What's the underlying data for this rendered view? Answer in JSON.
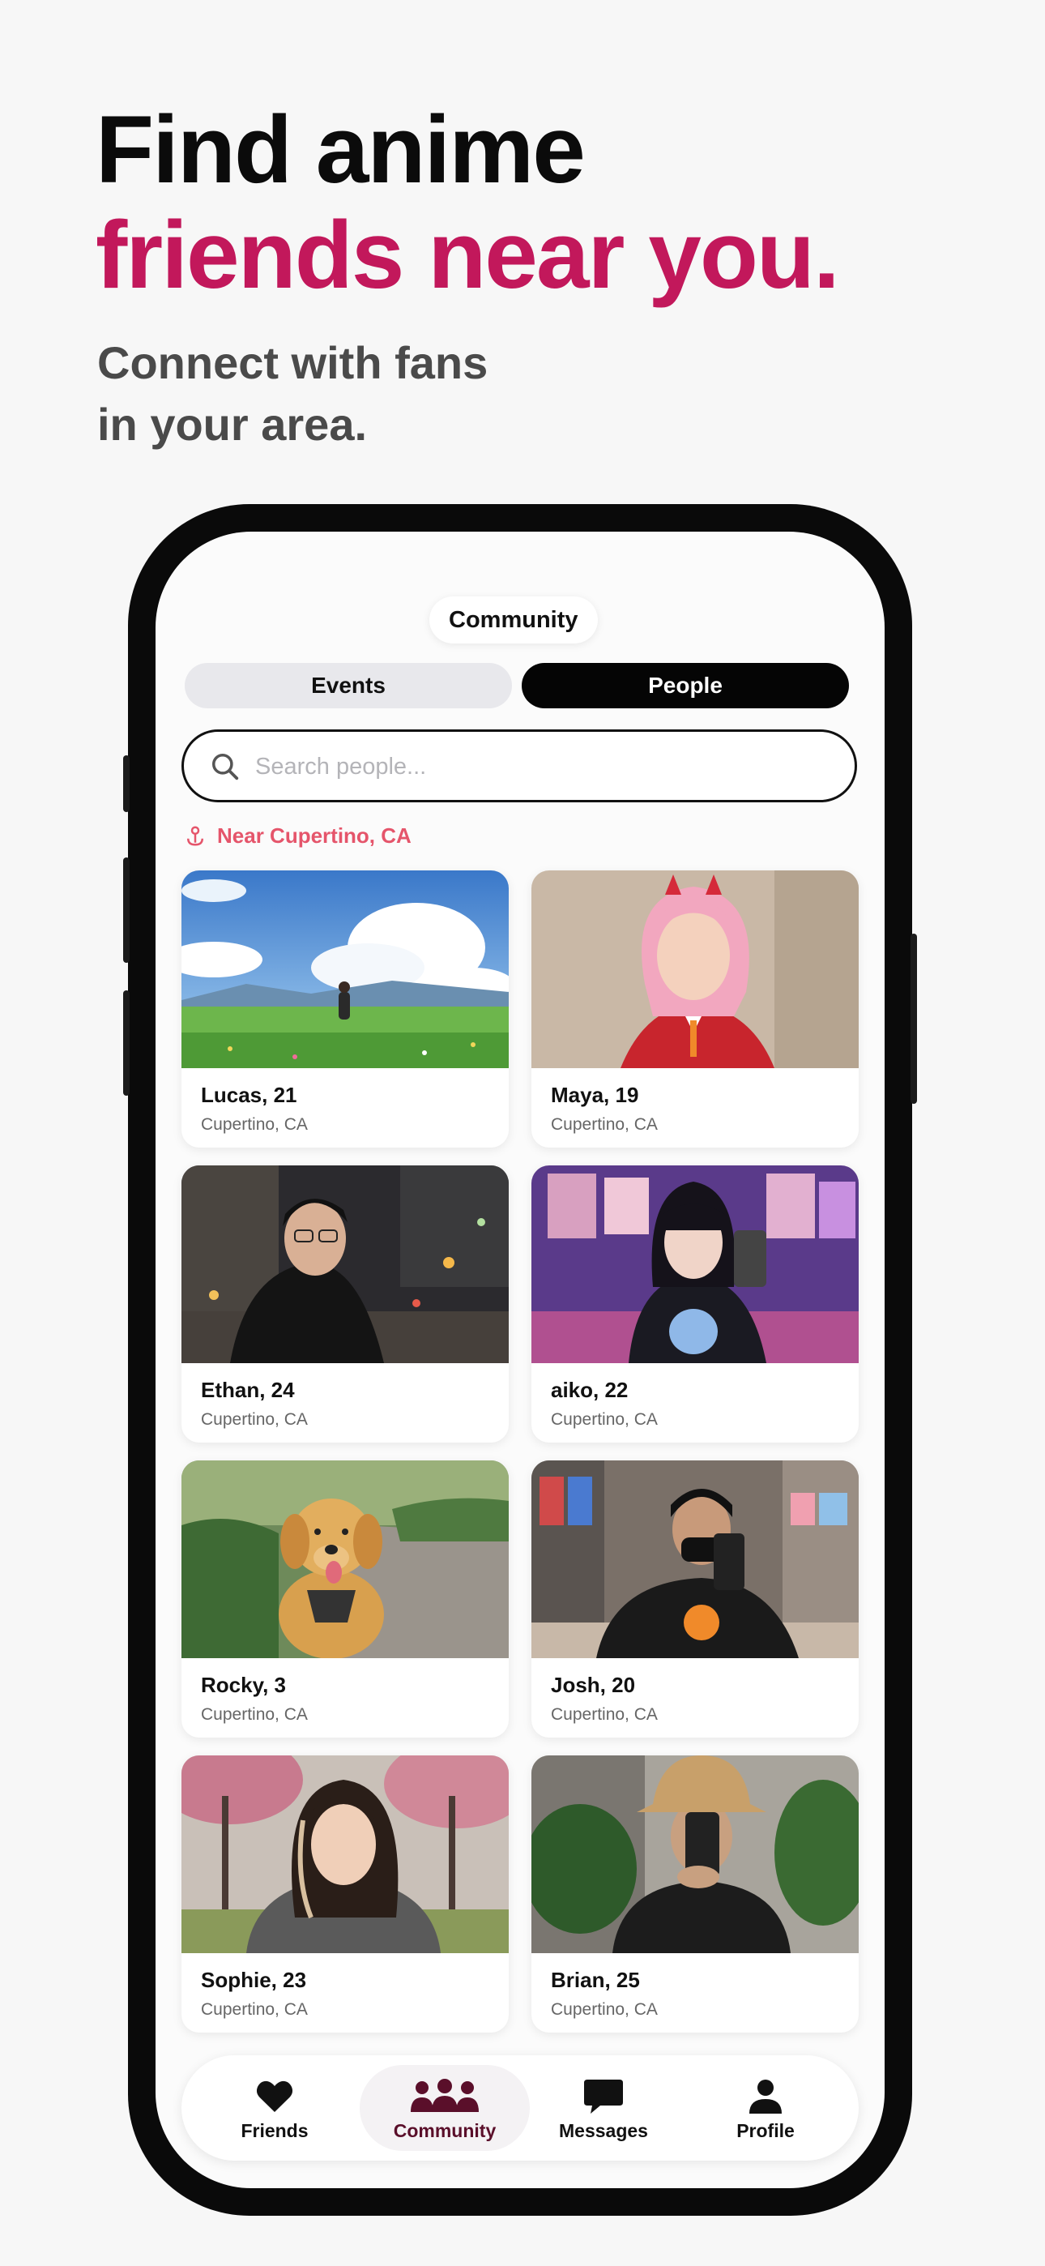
{
  "headline": {
    "line1": "Find anime",
    "line2": "friends near you."
  },
  "subline": {
    "line1": "Connect with fans",
    "line2": "in your area."
  },
  "app": {
    "title": "Community",
    "segments": {
      "events": "Events",
      "people": "People",
      "active": "People"
    },
    "search": {
      "placeholder": "Search people...",
      "value": ""
    },
    "location": "Near Cupertino, CA",
    "people": [
      {
        "name": "Lucas, 21",
        "city": "Cupertino, CA",
        "photo": "anime-landscape"
      },
      {
        "name": "Maya, 19",
        "city": "Cupertino, CA",
        "photo": "cosplay-portrait"
      },
      {
        "name": "Ethan, 24",
        "city": "Cupertino, CA",
        "photo": "city-night-portrait"
      },
      {
        "name": "aiko, 22",
        "city": "Cupertino, CA",
        "photo": "purple-room-selfie"
      },
      {
        "name": "Rocky, 3",
        "city": "Cupertino, CA",
        "photo": "golden-retriever"
      },
      {
        "name": "Josh, 20",
        "city": "Cupertino, CA",
        "photo": "store-selfie"
      },
      {
        "name": "Sophie, 23",
        "city": "Cupertino, CA",
        "photo": "cherry-blossom-portrait"
      },
      {
        "name": "Brian, 25",
        "city": "Cupertino, CA",
        "photo": "bucket-hat-selfie"
      }
    ],
    "tabs": [
      {
        "label": "Friends",
        "icon": "heart-icon"
      },
      {
        "label": "Community",
        "icon": "people-group-icon",
        "active": true
      },
      {
        "label": "Messages",
        "icon": "chat-bubble-icon"
      },
      {
        "label": "Profile",
        "icon": "person-icon"
      }
    ]
  },
  "colors": {
    "accent": "#c2185b",
    "location": "#e5556b",
    "active_tab": "#5a0f2a"
  }
}
